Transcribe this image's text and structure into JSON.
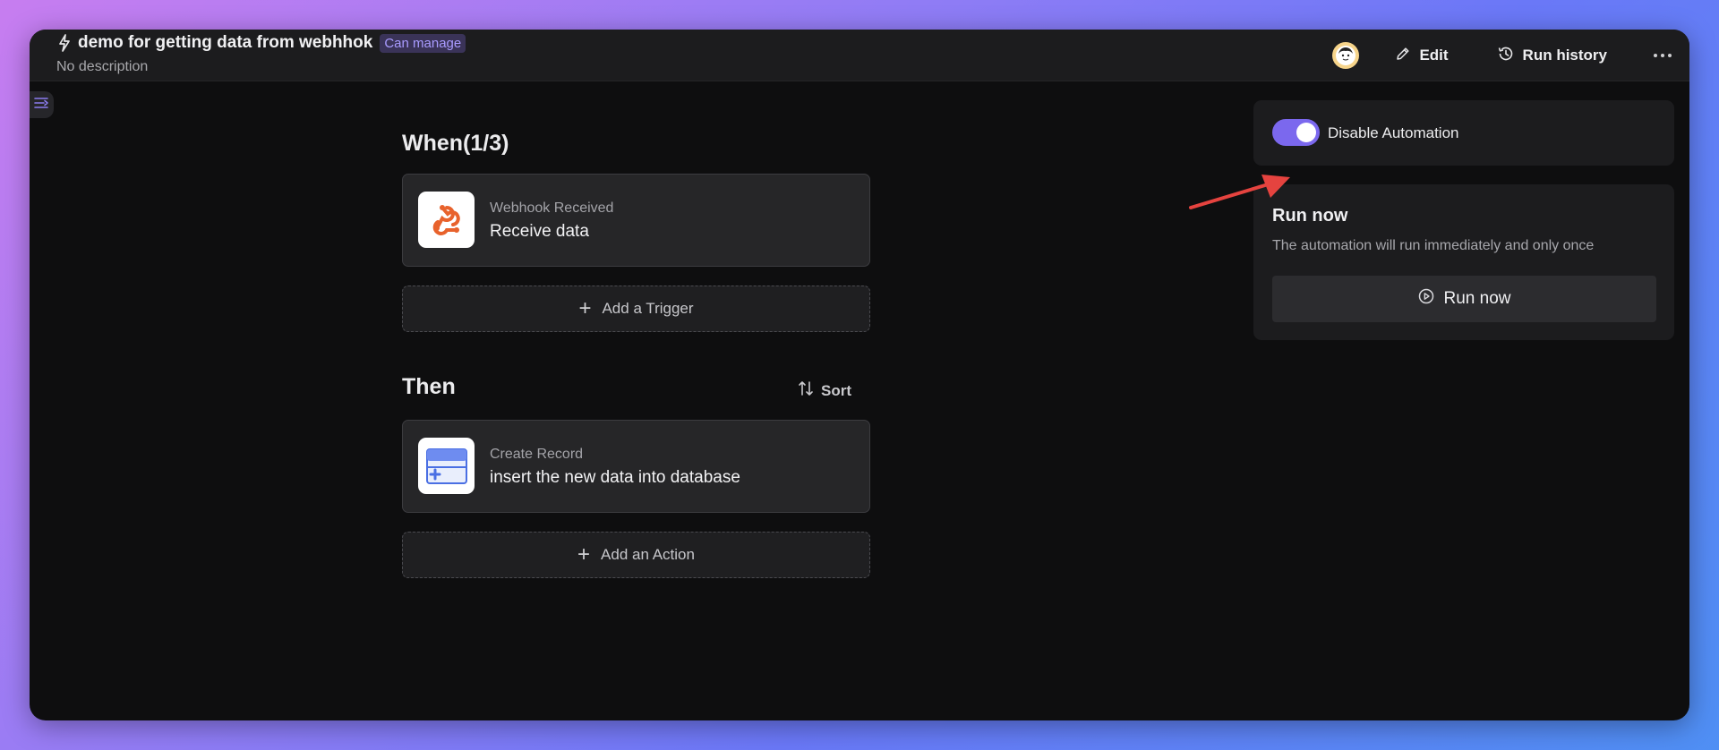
{
  "header": {
    "title": "demo for getting data from webhhok",
    "permission_badge": "Can manage",
    "description": "No description",
    "edit_label": "Edit",
    "run_history_label": "Run history"
  },
  "trigger_section": {
    "title": "When(1/3)",
    "card": {
      "kind": "Webhook Received",
      "name": "Receive data",
      "icon": "webhook-icon"
    },
    "add_label": "Add a Trigger"
  },
  "action_section": {
    "title": "Then",
    "sort_label": "Sort",
    "card": {
      "kind": "Create Record",
      "name": "insert the new data into database",
      "icon": "create-record-icon"
    },
    "add_label": "Add an Action"
  },
  "automation_panel": {
    "toggle_label": "Disable Automation",
    "toggle_on": true
  },
  "run_panel": {
    "title": "Run now",
    "description": "The automation will run immediately and only once",
    "button_label": "Run now"
  },
  "colors": {
    "accent": "#7b68ee",
    "webhook_orange": "#e8622c",
    "record_blue": "#4a6fe3",
    "annotation_red": "#e5433f"
  }
}
